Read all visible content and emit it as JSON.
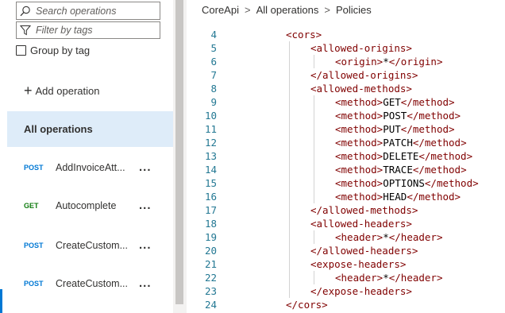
{
  "left": {
    "search_placeholder": "Search operations",
    "filter_placeholder": "Filter by tags",
    "group_by_tag": "Group by tag",
    "add_operation": "Add operation",
    "all_operations": "All operations",
    "operations": [
      {
        "method": "POST",
        "name": "AddInvoiceAtt..."
      },
      {
        "method": "GET",
        "name": "Autocomplete"
      },
      {
        "method": "POST",
        "name": "CreateCustom..."
      },
      {
        "method": "POST",
        "name": "CreateCustom..."
      }
    ],
    "more_glyph": "..."
  },
  "breadcrumb": {
    "items": [
      "CoreApi",
      "All operations",
      "Policies"
    ],
    "separator": ">"
  },
  "editor": {
    "lines": [
      {
        "n": "4",
        "indent": 0,
        "open": "<cors>"
      },
      {
        "n": "5",
        "indent": 1,
        "open": "<allowed-origins>"
      },
      {
        "n": "6",
        "indent": 2,
        "open": "<origin>",
        "text": "*",
        "close": "</origin>"
      },
      {
        "n": "7",
        "indent": 1,
        "close": "</allowed-origins>"
      },
      {
        "n": "8",
        "indent": 1,
        "open": "<allowed-methods>"
      },
      {
        "n": "9",
        "indent": 2,
        "open": "<method>",
        "text": "GET",
        "close": "</method>"
      },
      {
        "n": "10",
        "indent": 2,
        "open": "<method>",
        "text": "POST",
        "close": "</method>"
      },
      {
        "n": "11",
        "indent": 2,
        "open": "<method>",
        "text": "PUT",
        "close": "</method>"
      },
      {
        "n": "12",
        "indent": 2,
        "open": "<method>",
        "text": "PATCH",
        "close": "</method>"
      },
      {
        "n": "13",
        "indent": 2,
        "open": "<method>",
        "text": "DELETE",
        "close": "</method>"
      },
      {
        "n": "14",
        "indent": 2,
        "open": "<method>",
        "text": "TRACE",
        "close": "</method>"
      },
      {
        "n": "15",
        "indent": 2,
        "open": "<method>",
        "text": "OPTIONS",
        "close": "</method>"
      },
      {
        "n": "16",
        "indent": 2,
        "open": "<method>",
        "text": "HEAD",
        "close": "</method>"
      },
      {
        "n": "17",
        "indent": 1,
        "close": "</allowed-methods>"
      },
      {
        "n": "18",
        "indent": 1,
        "open": "<allowed-headers>"
      },
      {
        "n": "19",
        "indent": 2,
        "open": "<header>",
        "text": "*",
        "close": "</header>"
      },
      {
        "n": "20",
        "indent": 1,
        "close": "</allowed-headers>"
      },
      {
        "n": "21",
        "indent": 1,
        "open": "<expose-headers>"
      },
      {
        "n": "22",
        "indent": 2,
        "open": "<header>",
        "text": "*",
        "close": "</header>"
      },
      {
        "n": "23",
        "indent": 1,
        "close": "</expose-headers>"
      },
      {
        "n": "24",
        "indent": 0,
        "close": "</cors>"
      }
    ]
  },
  "colors": {
    "accent": "#0078d4",
    "selected_bg": "#deecf9",
    "get_method": "#107c10",
    "xml_tag": "#800000",
    "line_number": "#237893"
  }
}
